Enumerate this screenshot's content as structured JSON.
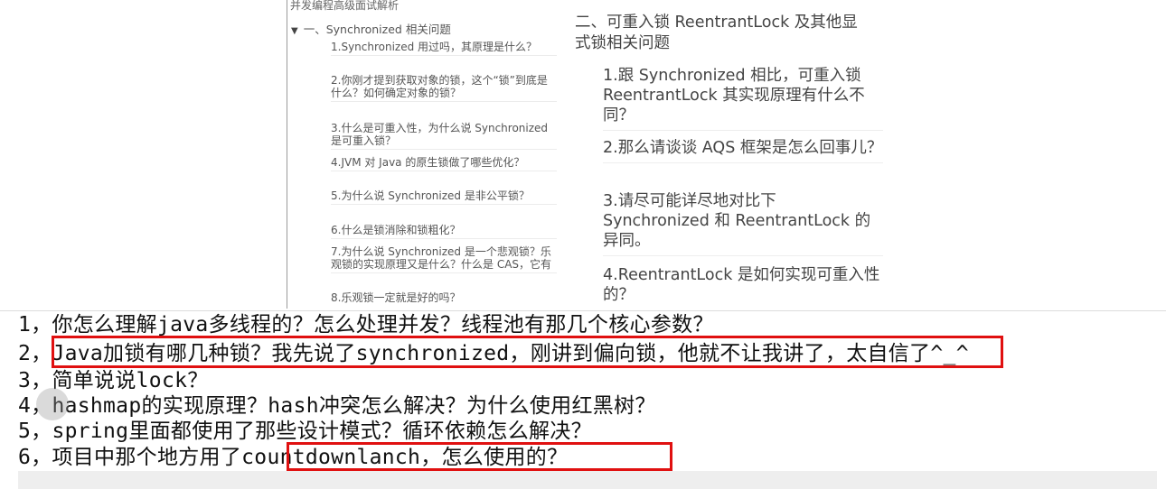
{
  "left_panel": {
    "title": "并发编程高级面试解析",
    "section": "一、Synchronized 相关问题",
    "items": [
      "1.Synchronized 用过吗，其原理是什么？",
      "2.你刚才提到获取对象的锁，这个“锁”到底是什么？如何确定对象的锁？",
      "3.什么是可重入性，为什么说 Synchronized 是可重入锁？",
      "4.JVM 对 Java 的原生锁做了哪些优化？",
      "5.为什么说 Synchronized 是非公平锁？",
      "6.什么是锁消除和锁粗化？",
      "7.为什么说 Synchronized 是一个悲观锁？乐观锁的实现原理又是什么？什么是 CAS，它有",
      "8.乐观锁一定就是好的吗？"
    ]
  },
  "right_panel": {
    "section": "二、可重入锁 ReentrantLock 及其他显式锁相关问题",
    "items": [
      "1.跟 Synchronized 相比，可重入锁 ReentrantLock 其实现原理有什么不同？",
      "2.那么请谈谈 AQS 框架是怎么回事儿？",
      "3.请尽可能详尽地对比下 Synchronized 和 ReentrantLock 的异同。",
      "4.ReentrantLock 是如何实现可重入性的？"
    ]
  },
  "notes": [
    "1，你怎么理解java多线程的？怎么处理并发？线程池有那几个核心参数？",
    "2，Java加锁有哪几种锁？我先说了synchronized，刚讲到偏向锁，他就不让我讲了，太自信了^_^",
    "3，简单说说lock？",
    "4，hashmap的实现原理？hash冲突怎么解决？为什么使用红黑树？",
    "5，spring里面都使用了那些设计模式？循环依赖怎么解决？",
    "6，项目中那个地方用了countdownlanch，怎么使用的？"
  ],
  "colors": {
    "highlight_box": "#e01010"
  }
}
